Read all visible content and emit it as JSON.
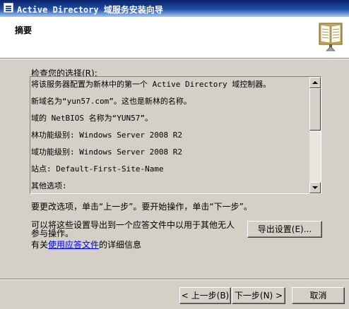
{
  "window": {
    "title": "Active Directory 域服务安装向导"
  },
  "header": {
    "heading": "摘要",
    "icon": "book-icon"
  },
  "review": {
    "label": "检查您的选择(R):",
    "lines": [
      "将该服务器配置为新林中的第一个 Active Directory 域控制器。",
      "新域名为“yun57.com”。这也是新林的名称。",
      "域的 NetBIOS 名称为“YUN57”。",
      "林功能级别: Windows Server 2008 R2",
      "域功能级别: Windows Server 2008 R2",
      "站点: Default-First-Site-Name",
      "其他选项:"
    ]
  },
  "nav_instructions": "要更改选项，单击“上一步”。要开始操作，单击“下一步”。",
  "export": {
    "text": "可以将这些设置导出到一个应答文件中以用于其他无人参与操作。",
    "button_label": "导出设置(E)..."
  },
  "more_info": {
    "prefix": "有关",
    "link": "使用应答文件",
    "suffix": "的详细信息"
  },
  "buttons": {
    "back": "< 上一步(B)",
    "next": "下一步(N) >",
    "cancel": "取消"
  }
}
